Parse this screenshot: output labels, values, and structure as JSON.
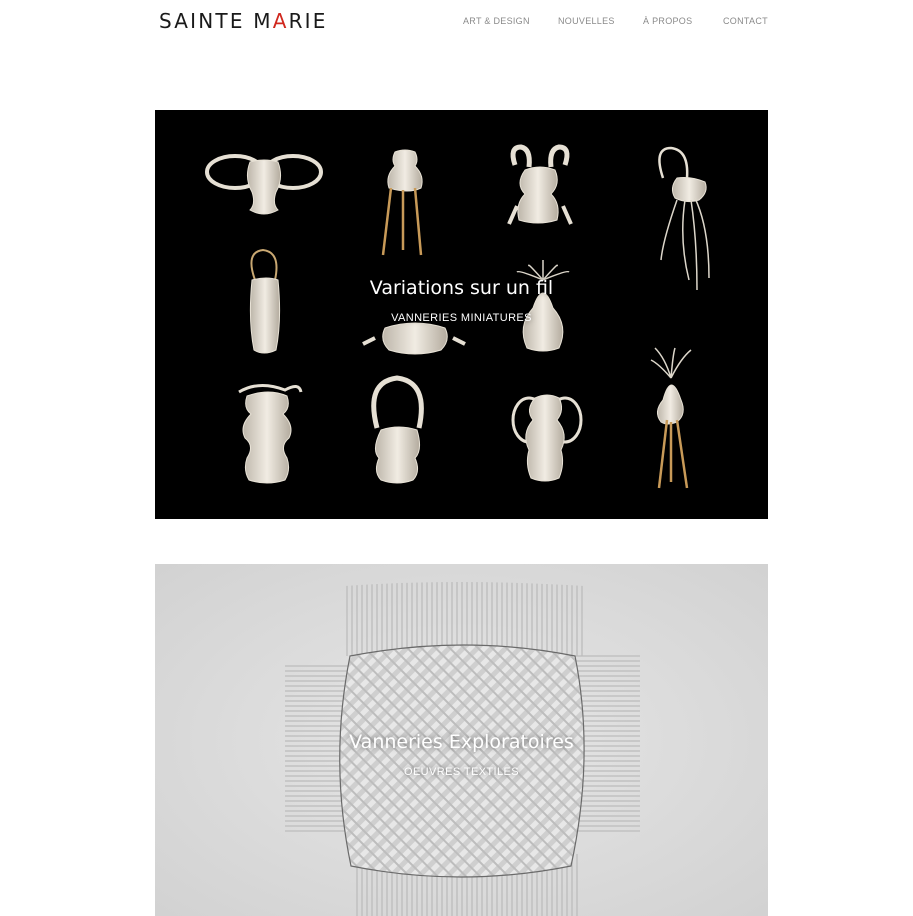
{
  "brand": {
    "logo_text_before": "SAINTE M",
    "logo_accent_letter": "A",
    "logo_text_after": "RIE",
    "accent_color": "#d0281e"
  },
  "nav": {
    "items": [
      {
        "label": "ART & DESIGN"
      },
      {
        "label": "NOUVELLES"
      },
      {
        "label": "À PROPOS"
      },
      {
        "label": "CONTACT"
      }
    ]
  },
  "projects": [
    {
      "title": "Variations sur un fil",
      "category": "VANNERIES MINIATURES",
      "background": "#000000"
    },
    {
      "title": "Vanneries Exploratoires",
      "category": "OEUVRES TEXTILES",
      "background": "#d9d9d9"
    }
  ]
}
